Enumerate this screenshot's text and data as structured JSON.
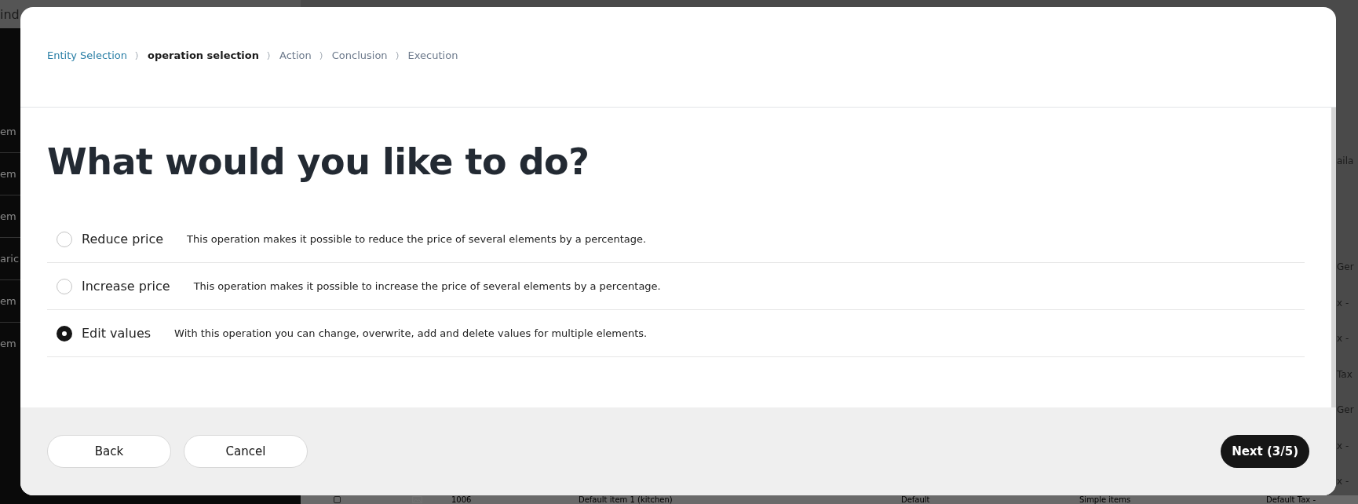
{
  "background": {
    "search_text": "ind",
    "sidebar_items": [
      "em",
      "em",
      "em",
      "aric",
      "em",
      "em"
    ],
    "right_column": [
      "aila",
      "Ger",
      "x -",
      "x -",
      "Tax",
      "Ger",
      "x -",
      "x -"
    ],
    "bottom_row": {
      "checked": false,
      "cells": [
        "1006",
        "Default item 1 (kitchen)",
        "Default",
        "Simple items",
        "Default Tax -"
      ]
    }
  },
  "dialog": {
    "breadcrumb": [
      {
        "label": "Entity Selection",
        "kind": "done"
      },
      {
        "label": "operation selection",
        "kind": "current"
      },
      {
        "label": "Action",
        "kind": "pending"
      },
      {
        "label": "Conclusion",
        "kind": "pending"
      },
      {
        "label": "Execution",
        "kind": "pending"
      }
    ],
    "title": "What would you like to do?",
    "options": [
      {
        "label": "Reduce price",
        "description": "This operation makes it possible to reduce the price of several elements by a percentage.",
        "selected": false
      },
      {
        "label": "Increase price",
        "description": "This operation makes it possible to increase the price of several elements by a percentage.",
        "selected": false
      },
      {
        "label": "Edit values",
        "description": "With this operation you can change, overwrite, add and delete values for multiple elements.",
        "selected": true
      }
    ],
    "buttons": [
      "Back",
      "Cancel"
    ],
    "next": "Next (3/5)"
  }
}
